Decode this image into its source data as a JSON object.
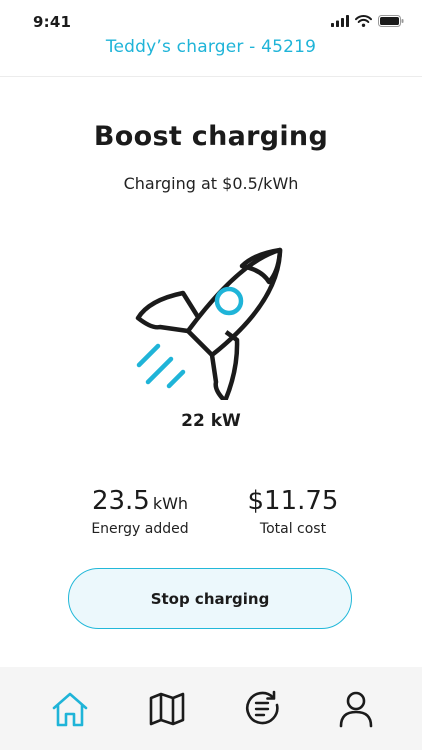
{
  "status_bar": {
    "time": "9:41"
  },
  "header": {
    "title": "Teddy’s charger - 45219"
  },
  "charging": {
    "mode_title": "Boost charging",
    "rate_text": "Charging at $0.5/kWh",
    "power": "22 kW"
  },
  "stats": {
    "energy": {
      "value": "23.5",
      "unit": "kWh",
      "label": "Energy added"
    },
    "cost": {
      "value": "$11.75",
      "label": "Total cost"
    }
  },
  "actions": {
    "stop_label": "Stop charging"
  },
  "nav": {
    "items": [
      {
        "icon": "home-icon",
        "active": true
      },
      {
        "icon": "map-icon",
        "active": false
      },
      {
        "icon": "history-icon",
        "active": false
      },
      {
        "icon": "profile-icon",
        "active": false
      }
    ]
  },
  "colors": {
    "accent": "#1fb4d8",
    "text": "#1b1b1b",
    "nav_background": "#f5f5f5",
    "button_background": "#ecf8fc"
  }
}
